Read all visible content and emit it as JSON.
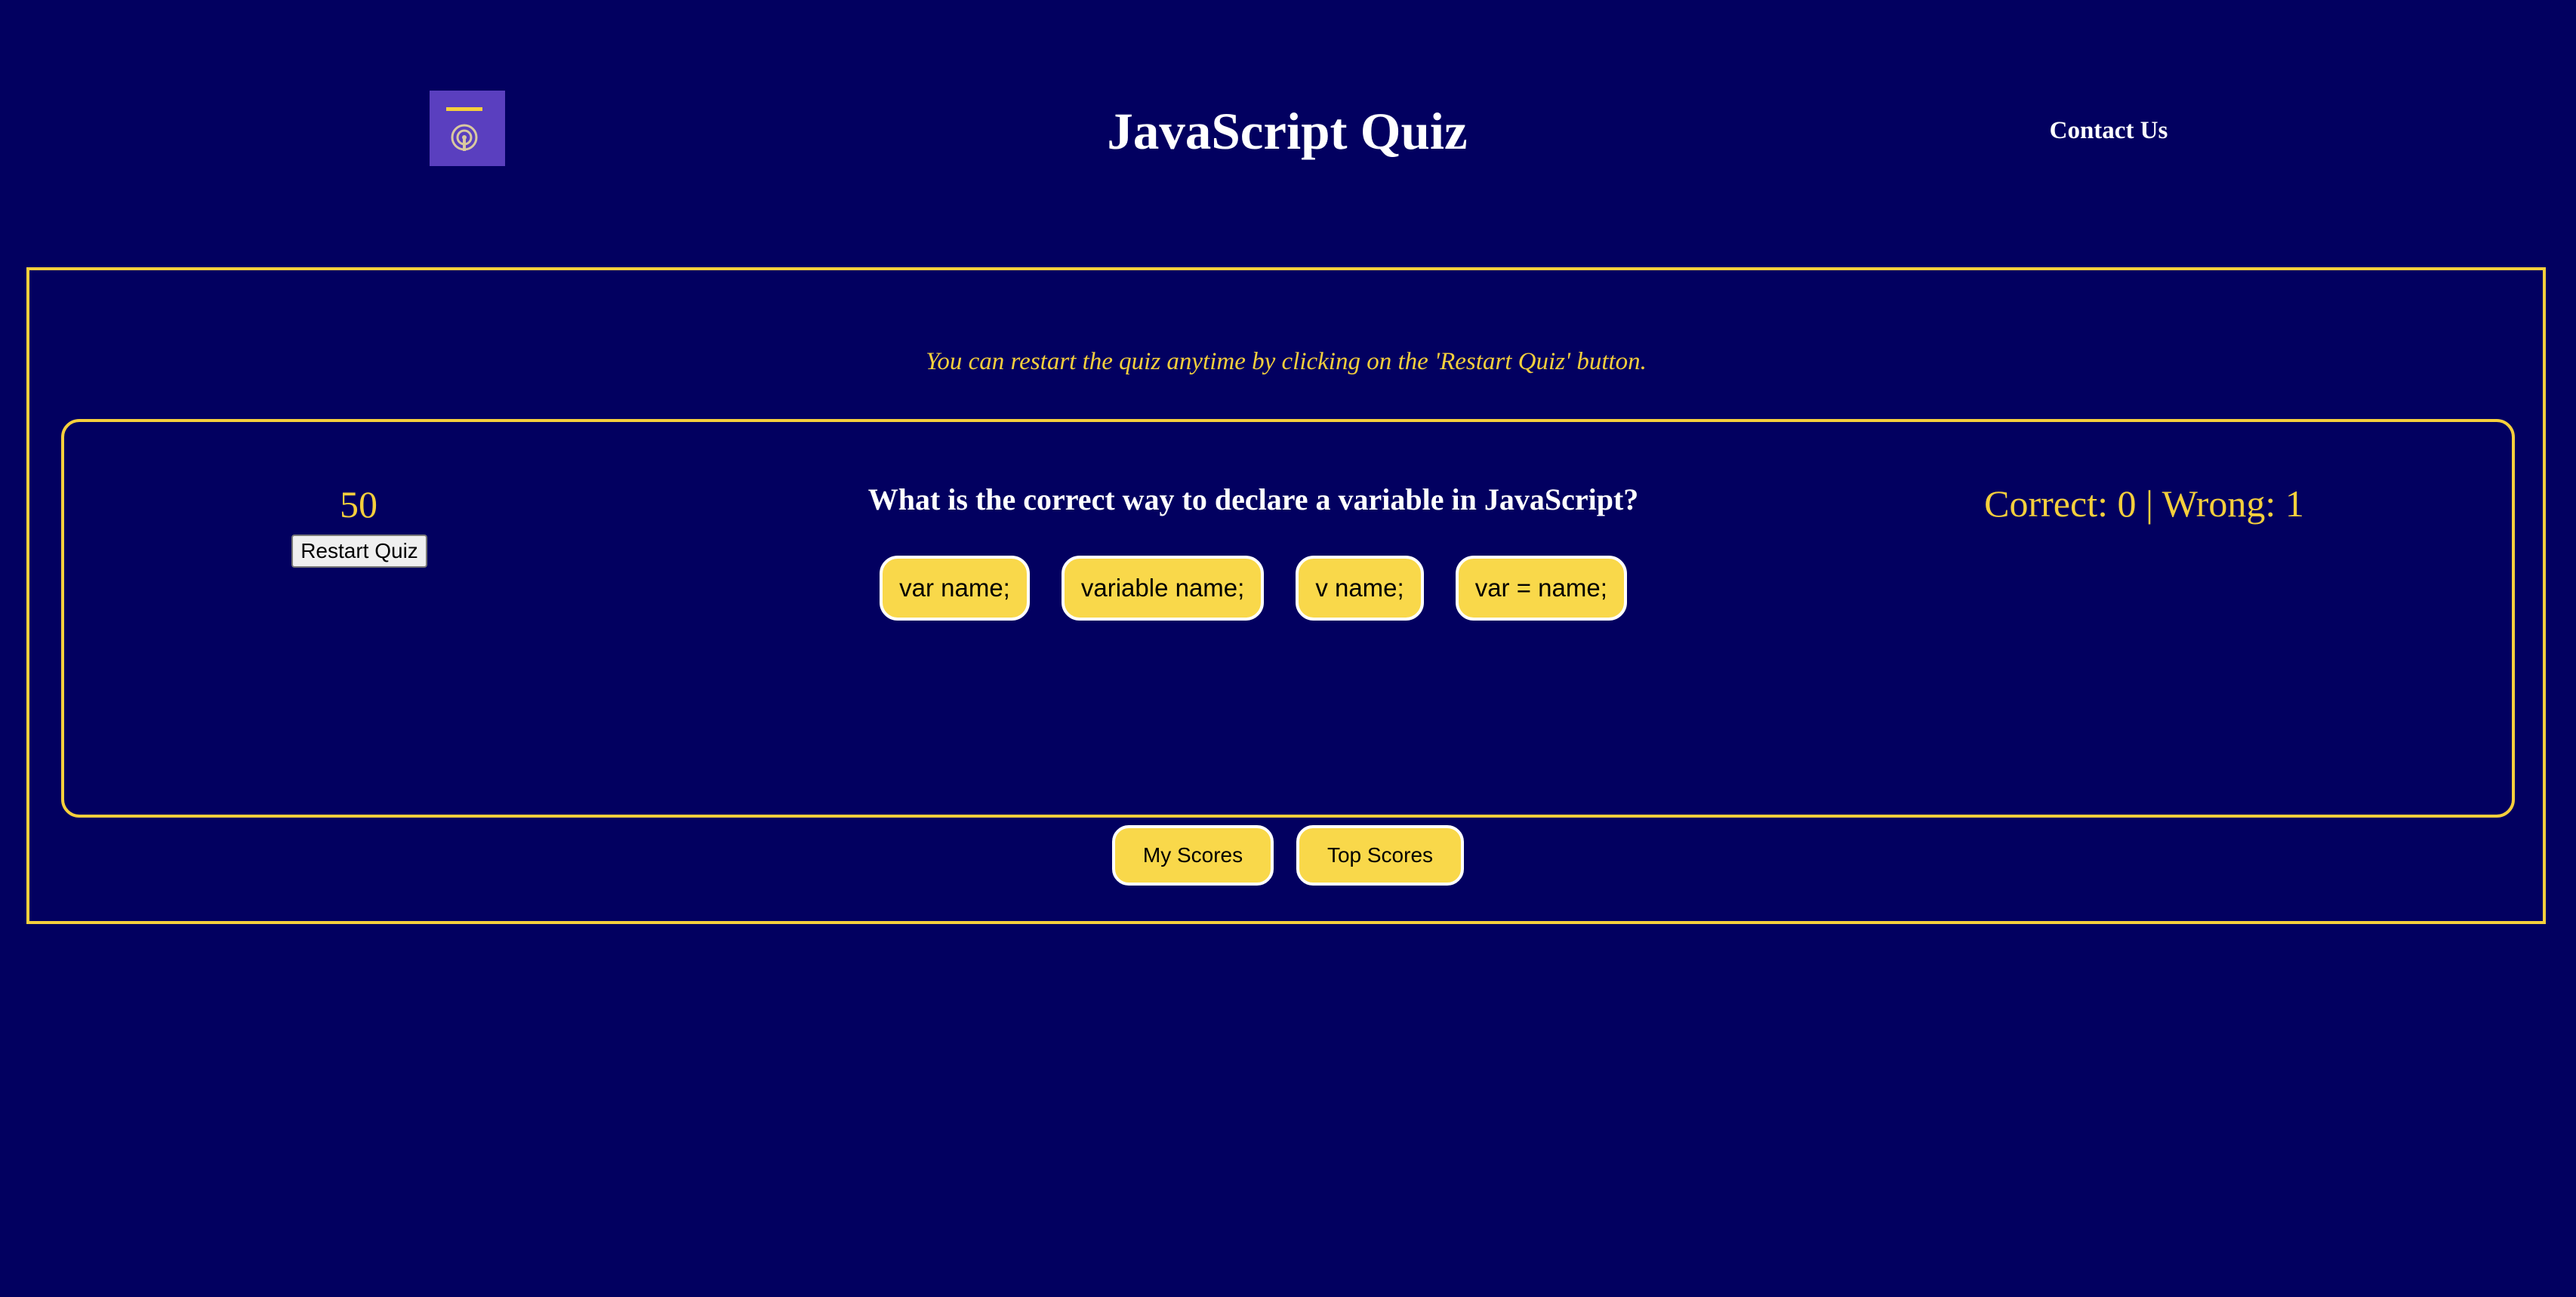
{
  "header": {
    "logo_icon": "podcast-icon",
    "title": "JavaScript Quiz",
    "contact_label": "Contact Us"
  },
  "quiz": {
    "hint": "You can restart the quiz anytime by clicking on the 'Restart Quiz' button.",
    "timer": "50",
    "restart_label": "Restart Quiz",
    "question": "What is the correct way to declare a variable in JavaScript?",
    "answers": [
      "var name;",
      "variable name;",
      "v name;",
      "var = name;"
    ],
    "score": "Correct: 0 | Wrong: 1"
  },
  "actions": {
    "my_scores_label": "My Scores",
    "top_scores_label": "Top Scores"
  },
  "colors": {
    "background": "#020060",
    "accent": "#f5cf3c",
    "button_fill": "#f9d84a",
    "logo_bg": "#5a3fbf",
    "text": "#ffffff"
  }
}
